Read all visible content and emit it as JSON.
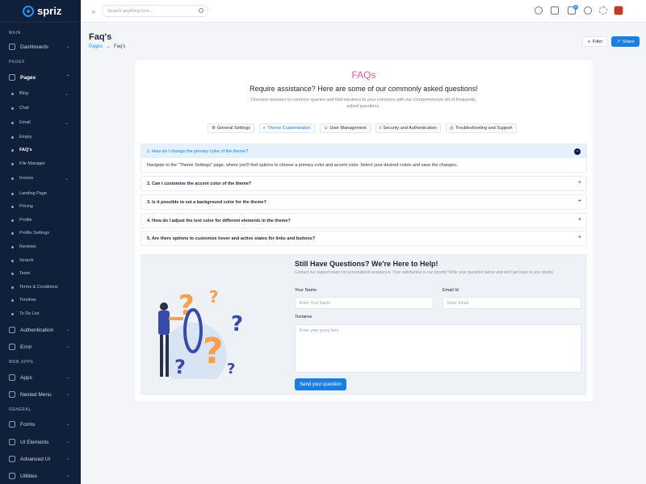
{
  "app": {
    "name": "spriz"
  },
  "search": {
    "placeholder": "Search anything here..."
  },
  "sidebar": {
    "sections": {
      "main": "MAIN",
      "pages": "PAGES",
      "web_apps": "WEB APPS",
      "general": "GENERAL"
    },
    "dashboards": "Dashboards",
    "pages": "Pages",
    "page_items": [
      "Blog",
      "Chat",
      "Email",
      "Empty",
      "FAQ's",
      "File Manager",
      "Invoice",
      "Landing Page",
      "Pricing",
      "Profile",
      "Profile Settings",
      "Reviews",
      "Search",
      "Team",
      "Terms & Conditions",
      "Timeline",
      "To Do List"
    ],
    "authentication": "Authentication",
    "error": "Error",
    "apps": "Apps",
    "nested_menu": "Nested Menu",
    "forms": "Forms",
    "ui_elements": "UI Elements",
    "advanced_ui": "Advanced UI",
    "utilities": "Utilities"
  },
  "topbar": {
    "badge_count": "5"
  },
  "header": {
    "title": "Faq's",
    "breadcrumb_root": "Pages",
    "breadcrumb_sep": "→",
    "breadcrumb_current": "Faq's",
    "filter_label": "Filter",
    "share_label": "Share"
  },
  "faq": {
    "heading": "FAQs",
    "subheading": "Require assistance? Here are some of our commonly asked questions!",
    "description": "Discover answers to common queries and find solutions to your concerns with our comprehensive list of frequently asked questions.",
    "tabs": [
      "General Settings",
      "Theme Customization",
      "User Management",
      "Security and Authentication",
      "Troubleshooting and Support"
    ],
    "active_tab": 1,
    "items": [
      {
        "q": "1. How do I change the primary color of the theme?",
        "a": "Navigate to the \"Theme Settings\" page, where you'll find options to choose a primary color and accent color. Select your desired colors and save the changes."
      },
      {
        "q": "2. Can I customize the accent color of the theme?"
      },
      {
        "q": "3. Is it possible to set a background color for the theme?"
      },
      {
        "q": "4. How do I adjust the text color for different elements in the theme?"
      },
      {
        "q": "5. Are there options to customize hover and active states for links and buttons?"
      }
    ]
  },
  "contact": {
    "title": "Still Have Questions? We're Here to Help!",
    "description": "Contact our support team for personalized assistance. Your satisfaction is our priority! Write your question below and we'll get back to you shortly.",
    "name_label": "Your Name",
    "name_placeholder": "Enter Your Name",
    "email_label": "Email Id",
    "email_placeholder": "Enter Email",
    "textarea_label": "Textarea",
    "textarea_placeholder": "Enter your query here",
    "submit_label": "Send your question"
  },
  "colors": {
    "sidebar_bg": "#10203a",
    "accent": "#1a7fe0",
    "faq_heading": "#e05aa6"
  }
}
